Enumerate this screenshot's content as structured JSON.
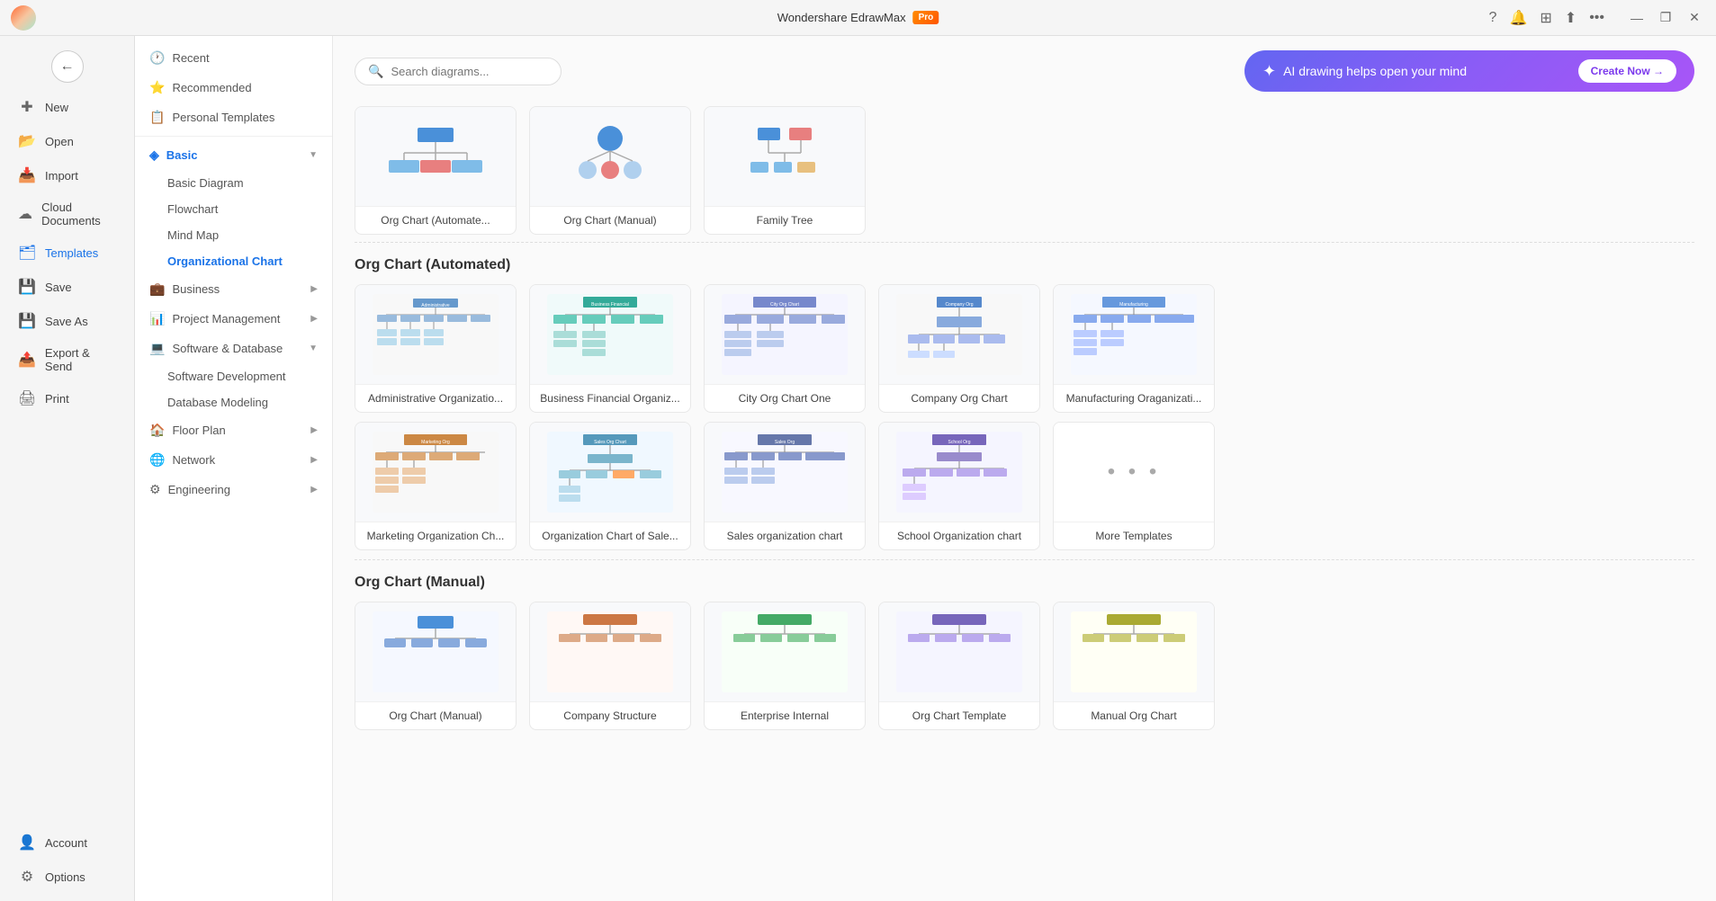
{
  "titlebar": {
    "title": "Wondershare EdrawMax",
    "pro_label": "Pro",
    "minimize": "—",
    "maximize": "❐",
    "close": "✕"
  },
  "toolbar_right": {
    "help_icon": "?",
    "bell_icon": "🔔",
    "grid_icon": "⚙",
    "share_icon": "↑",
    "more_icon": "…"
  },
  "search": {
    "placeholder": "Search diagrams..."
  },
  "ai_banner": {
    "icon": "✦",
    "text": "AI drawing helps open your mind",
    "button": "Create Now →"
  },
  "left_nav": {
    "back_icon": "←",
    "items": [
      {
        "id": "new",
        "label": "New",
        "icon": "＋"
      },
      {
        "id": "open",
        "label": "Open",
        "icon": "📂"
      },
      {
        "id": "import",
        "label": "Import",
        "icon": "📥"
      },
      {
        "id": "cloud",
        "label": "Cloud Documents",
        "icon": "☁"
      },
      {
        "id": "templates",
        "label": "Templates",
        "icon": "🗂",
        "active": true
      },
      {
        "id": "save",
        "label": "Save",
        "icon": "💾"
      },
      {
        "id": "saveas",
        "label": "Save As",
        "icon": "💾"
      },
      {
        "id": "export",
        "label": "Export & Send",
        "icon": "📤"
      },
      {
        "id": "print",
        "label": "Print",
        "icon": "🖨"
      }
    ],
    "bottom": [
      {
        "id": "account",
        "label": "Account",
        "icon": "👤"
      },
      {
        "id": "options",
        "label": "Options",
        "icon": "⚙"
      }
    ]
  },
  "categories": {
    "top_items": [
      {
        "id": "recent",
        "label": "Recent",
        "icon": "🕐"
      },
      {
        "id": "recommended",
        "label": "Recommended",
        "icon": "⭐"
      },
      {
        "id": "personal",
        "label": "Personal Templates",
        "icon": "📋"
      }
    ],
    "sections": [
      {
        "id": "basic",
        "label": "Basic",
        "icon": "◈",
        "expanded": true,
        "active": true,
        "sub_items": [
          {
            "id": "basic-diagram",
            "label": "Basic Diagram"
          },
          {
            "id": "flowchart",
            "label": "Flowchart"
          },
          {
            "id": "mindmap",
            "label": "Mind Map"
          },
          {
            "id": "orgchart",
            "label": "Organizational Chart",
            "active": true
          }
        ]
      },
      {
        "id": "business",
        "label": "Business",
        "icon": "💼",
        "expandable": true
      },
      {
        "id": "project",
        "label": "Project Management",
        "icon": "📊",
        "expandable": true
      },
      {
        "id": "software",
        "label": "Software & Database",
        "icon": "💻",
        "expanded": true,
        "expandable": true,
        "sub_items": [
          {
            "id": "software-dev",
            "label": "Software Development"
          },
          {
            "id": "db-modeling",
            "label": "Database Modeling"
          }
        ]
      },
      {
        "id": "floorplan",
        "label": "Floor Plan",
        "icon": "🏠",
        "expandable": true
      },
      {
        "id": "network",
        "label": "Network",
        "icon": "🌐",
        "expandable": true
      },
      {
        "id": "engineering",
        "label": "Engineering",
        "icon": "⚙",
        "expandable": true
      }
    ]
  },
  "main": {
    "quick_templates": [
      {
        "id": "org-auto",
        "label": "Org Chart (Automate...",
        "type": "org-auto"
      },
      {
        "id": "org-manual",
        "label": "Org Chart (Manual)",
        "type": "org-manual"
      },
      {
        "id": "family-tree",
        "label": "Family Tree",
        "type": "family-tree"
      }
    ],
    "section_automated": {
      "title": "Org Chart (Automated)",
      "templates": [
        {
          "id": "admin-org",
          "label": "Administrative Organizatio...",
          "type": "admin"
        },
        {
          "id": "biz-fin",
          "label": "Business Financial Organiz...",
          "type": "biz-fin"
        },
        {
          "id": "city-org",
          "label": "City Org Chart One",
          "type": "city"
        },
        {
          "id": "company-org",
          "label": "Company Org Chart",
          "type": "company"
        },
        {
          "id": "mfg-org",
          "label": "Manufacturing Oraganizati...",
          "type": "mfg"
        }
      ]
    },
    "section_automated_row2": {
      "templates": [
        {
          "id": "mkt-org",
          "label": "Marketing Organization Ch...",
          "type": "mkt"
        },
        {
          "id": "sales-chart",
          "label": "Organization Chart of Sale...",
          "type": "sales-chart"
        },
        {
          "id": "sales-org",
          "label": "Sales organization chart",
          "type": "sales-org"
        },
        {
          "id": "school-org",
          "label": "School Organization chart",
          "type": "school"
        },
        {
          "id": "more-tpl",
          "label": "More Templates",
          "type": "more"
        }
      ]
    },
    "section_manual": {
      "title": "Org Chart (Manual)"
    }
  }
}
